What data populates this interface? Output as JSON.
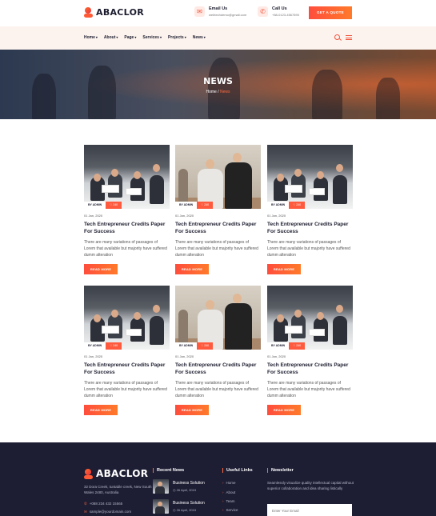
{
  "header": {
    "logo_text": "ABACLOR",
    "email": {
      "label": "Email Us",
      "value": "webtechdemo@gmail.com",
      "icon": "mail-icon"
    },
    "call": {
      "label": "Call Us",
      "value": "+88-0123-4567890",
      "icon": "phone-icon"
    },
    "cta": "GET A QUOTE"
  },
  "nav": {
    "items": [
      "Home",
      "About",
      "Page",
      "Services",
      "Projects",
      "News"
    ],
    "search_icon": "search-icon",
    "menu_icon": "hamburger-icon"
  },
  "hero": {
    "title": "NEWS",
    "breadcrumb_home": "Home",
    "breadcrumb_sep": "/",
    "breadcrumb_current": "News"
  },
  "posts": [
    {
      "author": "BY ADMIN",
      "likes": "240",
      "date": "01 Jan, 2020",
      "title": "Tech Entrepreneur Credits Paper For Success",
      "excerpt": "There are many variations of passages of Lorem that available but majority have suffered dumm alteration",
      "cta": "READ MORE",
      "image": "meeting"
    },
    {
      "author": "BY ADMIN",
      "likes": "240",
      "date": "01 Jan, 2020",
      "title": "Tech Entrepreneur Credits Paper For Success",
      "excerpt": "There are many variations of passages of Lorem that available but majority have suffered dumm alteration",
      "cta": "READ MORE",
      "image": "coder"
    },
    {
      "author": "BY ADMIN",
      "likes": "240",
      "date": "01 Jan, 2020",
      "title": "Tech Entrepreneur Credits Paper For Success",
      "excerpt": "There are many variations of passages of Lorem that available but majority have suffered dumm alteration",
      "cta": "READ MORE",
      "image": "meeting"
    },
    {
      "author": "BY ADMIN",
      "likes": "240",
      "date": "01 Jan, 2020",
      "title": "Tech Entrepreneur Credits Paper For Success",
      "excerpt": "There are many variations of passages of Lorem that available but majority have suffered dumm alteration",
      "cta": "READ MORE",
      "image": "meeting"
    },
    {
      "author": "BY ADMIN",
      "likes": "240",
      "date": "01 Jan, 2020",
      "title": "Tech Entrepreneur Credits Paper For Success",
      "excerpt": "There are many variations of passages of Lorem that available but majority have suffered dumm alteration",
      "cta": "READ MORE",
      "image": "coder"
    },
    {
      "author": "BY ADMIN",
      "likes": "240",
      "date": "01 Jan, 2020",
      "title": "Tech Entrepreneur Credits Paper For Success",
      "excerpt": "There are many variations of passages of Lorem that available but majority have suffered dumm alteration",
      "cta": "READ MORE",
      "image": "meeting"
    }
  ],
  "footer": {
    "logo_text": "ABACLOR",
    "address": "32 Dora Creek, tuntable creek, New South Wales 2480, Australia",
    "phone": "+088 234 432 15565",
    "email": "sample@yourdomain.com",
    "recent_news_title": "Recent News",
    "recent_news": [
      {
        "title": "Business Solution",
        "date": "26 April, 2019"
      },
      {
        "title": "Business Solution",
        "date": "26 April, 2019"
      }
    ],
    "links_title": "Useful Links",
    "links": [
      "Home",
      "About",
      "Team",
      "Service"
    ],
    "newsletter_title": "Newsletter",
    "newsletter_text": "Seamlessly visualize quality intellectual capital without superior collaboration and idea sharing listically",
    "newsletter_placeholder": "Enter Your Email"
  },
  "colors": {
    "accent": "#ff5a3d",
    "footer_bg": "#1d1d34",
    "nav_bg": "#fdf3ee"
  }
}
